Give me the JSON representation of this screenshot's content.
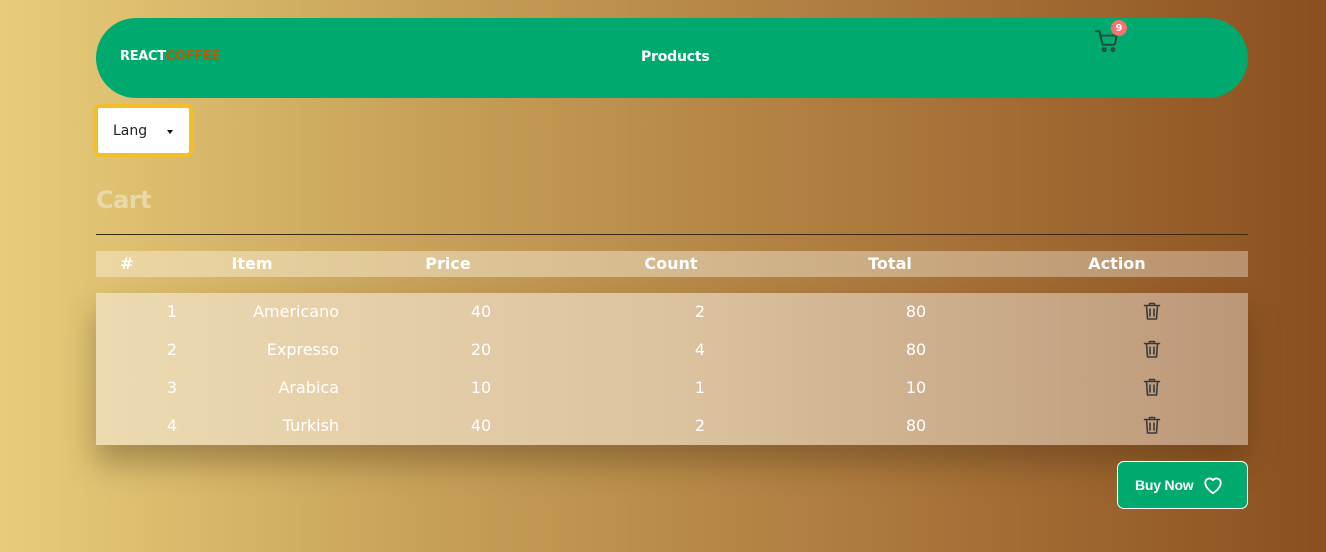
{
  "navbar": {
    "brand_part1": "REACT",
    "brand_part2": "COFFEE",
    "products_label": "Products",
    "cart_icon": "shopping-cart-icon",
    "cart_count": "9"
  },
  "lang_select": {
    "label": "Lang",
    "icon": "caret-down-icon"
  },
  "cart": {
    "title": "Cart",
    "headers": [
      "#",
      "Item",
      "Price",
      "Count",
      "Total",
      "Action"
    ],
    "rows": [
      {
        "num": "1",
        "item": "Americano",
        "price": "40",
        "count": "2",
        "total": "80"
      },
      {
        "num": "2",
        "item": "Expresso",
        "price": "20",
        "count": "4",
        "total": "80"
      },
      {
        "num": "3",
        "item": "Arabica",
        "price": "10",
        "count": "1",
        "total": "10"
      },
      {
        "num": "4",
        "item": "Turkish",
        "price": "40",
        "count": "2",
        "total": "80"
      }
    ],
    "action_icon": "trash-icon"
  },
  "buy_button": {
    "label": "Buy Now",
    "icon": "heart-icon"
  },
  "colors": {
    "primary": "#00a96e",
    "brand_accent": "#b55a08",
    "badge": "#f87272",
    "lang_border": "#f2bf2a"
  }
}
